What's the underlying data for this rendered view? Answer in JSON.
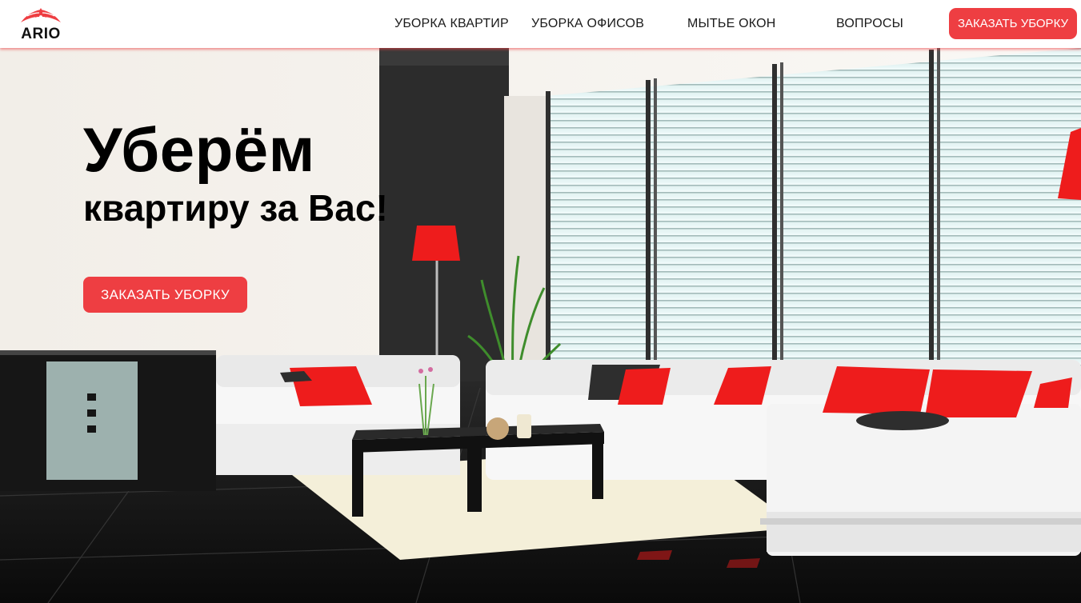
{
  "brand": {
    "name": "ARIO",
    "accent_color": "#ee3e42"
  },
  "nav": {
    "items": [
      {
        "label": "УБОРКА КВАРТИР"
      },
      {
        "label": "УБОРКА ОФИСОВ"
      },
      {
        "label": "МЫТЬЕ ОКОН"
      },
      {
        "label": "ВОПРОСЫ"
      }
    ],
    "cta_label": "ЗАКАЗАТЬ УБОРКУ"
  },
  "hero": {
    "title": "Уберём",
    "subtitle": "квартиру за Вас!",
    "cta_label": "ЗАКАЗАТЬ УБОРКУ",
    "background": "living-room-photo"
  }
}
